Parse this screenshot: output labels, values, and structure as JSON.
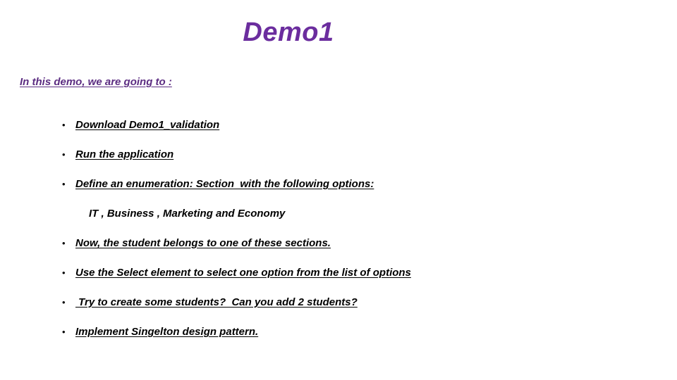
{
  "slide": {
    "title": "Demo1",
    "intro": "In this demo, we are going to :",
    "colors": {
      "title_purple": "#6b2d9e",
      "intro_purple": "#5c2d82",
      "body_black": "#000000",
      "background": "#ffffff"
    },
    "bullet_glyph": "•",
    "items": [
      {
        "type": "bullet",
        "text": "Download Demo1_validation"
      },
      {
        "type": "bullet",
        "text": "Run the application"
      },
      {
        "type": "bullet",
        "text": "Define an enumeration: Section  with the following options:"
      },
      {
        "type": "sub",
        "text": "IT , Business , Marketing and Economy"
      },
      {
        "type": "bullet",
        "text": "Now, the student belongs to one of these sections."
      },
      {
        "type": "bullet",
        "text": "Use the Select element to select one option from the list of options"
      },
      {
        "type": "bullet",
        "text": " Try to create some students?  Can you add 2 students?"
      },
      {
        "type": "bullet",
        "text": "Implement Singelton design pattern."
      }
    ]
  }
}
